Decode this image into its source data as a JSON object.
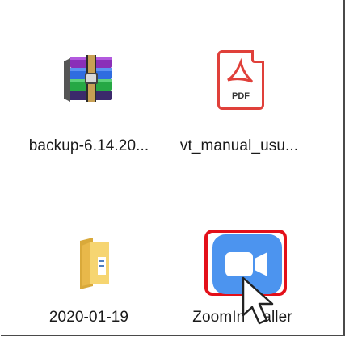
{
  "files": [
    {
      "name": "backup-6.14.20...",
      "icon": "winrar-archive-icon"
    },
    {
      "name": "vt_manual_usu...",
      "icon": "pdf-file-icon",
      "icon_text": "PDF"
    },
    {
      "name": "2020-01-19",
      "icon": "folder-icon"
    },
    {
      "name": "ZoomInstaller",
      "icon": "zoom-app-icon",
      "visible_label": "ZoomIn",
      "visible_label_tail": "aller"
    }
  ],
  "colors": {
    "highlight": "#e3101a",
    "zoom_blue": "#4c94ef",
    "pdf_red": "#e0403a",
    "folder": "#f2c94c"
  }
}
